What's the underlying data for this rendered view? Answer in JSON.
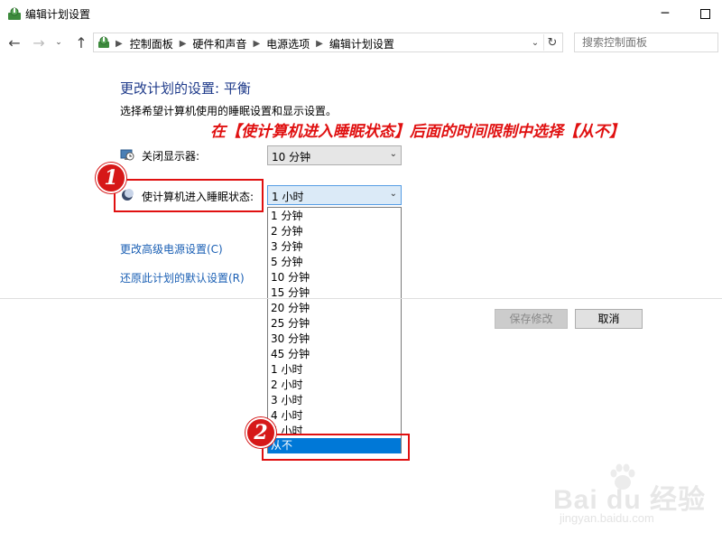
{
  "window": {
    "title": "编辑计划设置"
  },
  "nav": {
    "breadcrumbs": [
      "控制面板",
      "硬件和声音",
      "电源选项",
      "编辑计划设置"
    ],
    "search_placeholder": "搜索控制面板"
  },
  "main": {
    "heading": "更改计划的设置: 平衡",
    "subtitle": "选择希望计算机使用的睡眠设置和显示设置。",
    "annotation": "在【使计算机进入睡眠状态】后面的时间限制中选择【从不】",
    "display_off": {
      "label": "关闭显示器:",
      "value": "10 分钟"
    },
    "sleep": {
      "label": "使计算机进入睡眠状态:",
      "value": "1 小时",
      "options": [
        "1 分钟",
        "2 分钟",
        "3 分钟",
        "5 分钟",
        "10 分钟",
        "15 分钟",
        "20 分钟",
        "25 分钟",
        "30 分钟",
        "45 分钟",
        "1 小时",
        "2 小时",
        "3 小时",
        "4 小时",
        "5 小时",
        "从不"
      ],
      "highlighted": "从不"
    },
    "links": {
      "advanced": "更改高级电源设置(C)",
      "restore": "还原此计划的默认设置(R)"
    },
    "buttons": {
      "save": "保存修改",
      "cancel": "取消"
    }
  },
  "badges": {
    "step1": "1",
    "step2": "2"
  },
  "watermark": {
    "logo": "Bai du 经验",
    "url": "jingyan.baidu.com"
  },
  "colors": {
    "accent": "#0078d7",
    "annotation": "#e01010",
    "heading": "#1e3a8a",
    "link": "#1a5fb4"
  }
}
